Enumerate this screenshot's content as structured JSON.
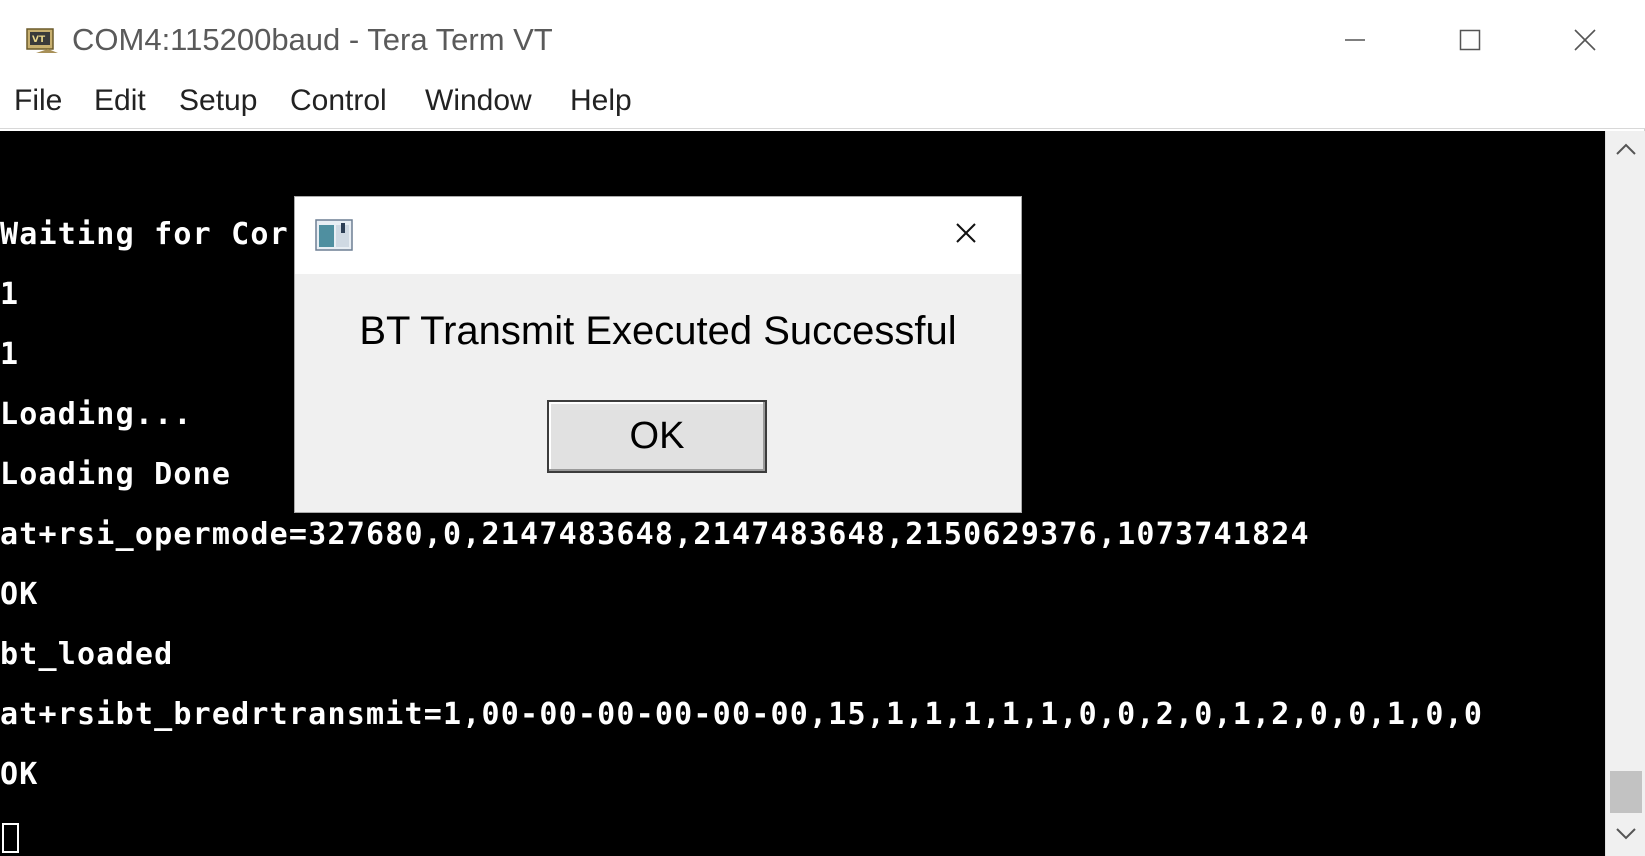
{
  "window": {
    "title": "COM4:115200baud - Tera Term VT",
    "icon": "teraterm-app-icon",
    "controls": {
      "minimize": "minimize-icon",
      "maximize": "maximize-icon",
      "close": "close-icon"
    }
  },
  "menubar": {
    "items": [
      "File",
      "Edit",
      "Setup",
      "Control",
      "Window",
      "Help"
    ]
  },
  "terminal": {
    "colors": {
      "background": "#000000",
      "foreground": "#ffffff"
    },
    "lines": [
      "Waiting for Cor",
      "1",
      "1",
      "Loading...",
      "Loading Done",
      "at+rsi_opermode=327680,0,2147483648,2147483648,2150629376,1073741824",
      "OK",
      "bt_loaded",
      "at+rsibt_bredrtransmit=1,00-00-00-00-00-00,15,1,1,1,1,1,0,0,2,0,1,2,0,0,1,0,0",
      "OK"
    ]
  },
  "dialog": {
    "icon": "window-app-icon",
    "message": "BT Transmit Executed Successful",
    "ok_label": "OK",
    "close_icon": "close-icon"
  },
  "scrollbar": {
    "up_icon": "chevron-up-icon",
    "down_icon": "chevron-down-icon"
  }
}
